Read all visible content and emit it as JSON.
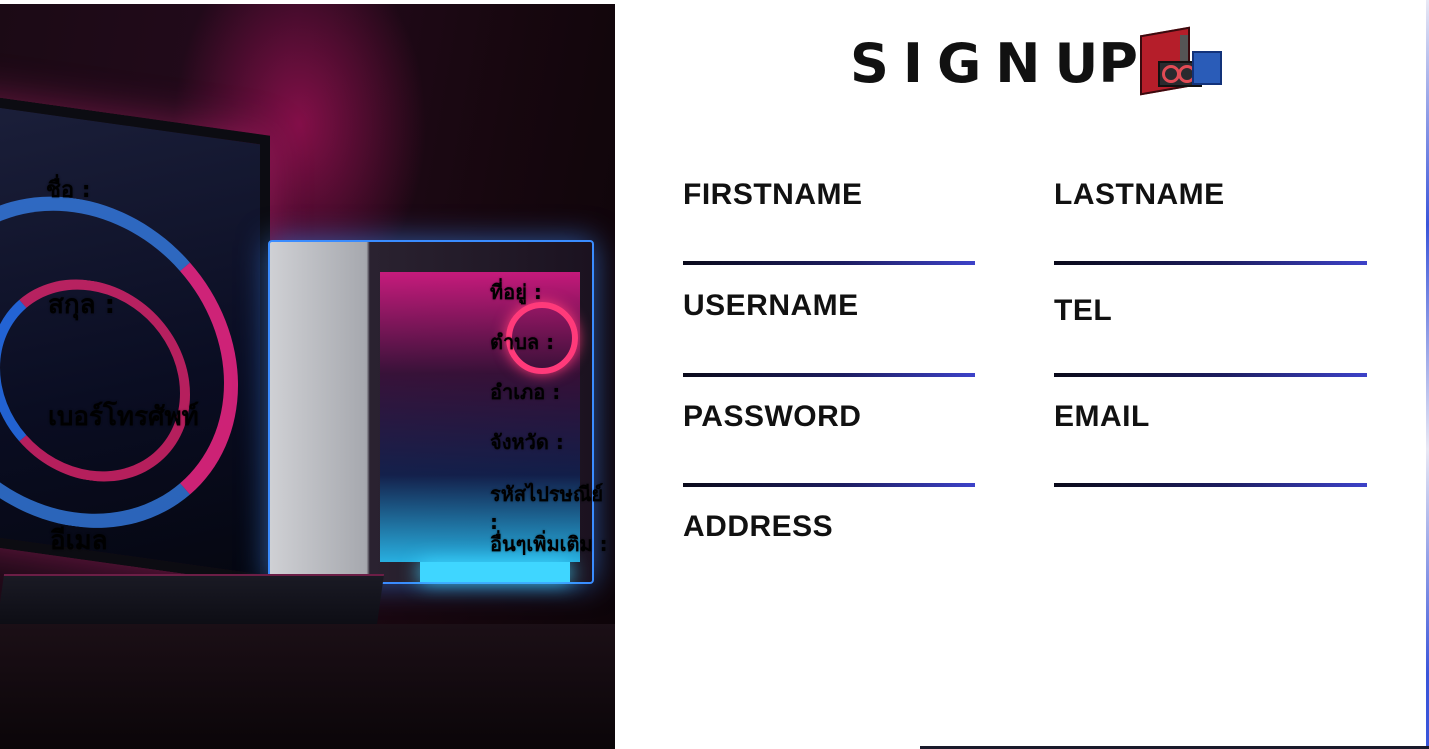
{
  "header": {
    "title_spaced": "SIGN",
    "title_tail": "UP",
    "icon": "computer-hardware-icon"
  },
  "hero": {
    "image": "gaming-pc-photo",
    "thai_labels": {
      "first_name": "ชื่อ :",
      "last_name": "สกุล :",
      "phone": "เบอร์โทรศัพท์",
      "email": "อีเมล",
      "address": "ที่อยู่ :",
      "subdistrict": "ตำบล :",
      "district": "อำเภอ :",
      "province": "จังหวัด :",
      "postal_code": "รหัสไปรษณีย์ :",
      "other": "อื่นๆเพิ่มเติม :"
    }
  },
  "form": {
    "firstname_label": "FIRSTNAME",
    "lastname_label": "LASTNAME",
    "username_label": "USERNAME",
    "tel_label": "TEL",
    "password_label": "PASSWORD",
    "email_label": "EMAIL",
    "address_label": "ADDRESS",
    "firstname_value": "",
    "lastname_value": "",
    "username_value": "",
    "tel_value": "",
    "password_value": "",
    "email_value": ""
  },
  "colors": {
    "underline_start": "#0a0a1a",
    "underline_end": "#3d42c9",
    "text": "#111111"
  }
}
